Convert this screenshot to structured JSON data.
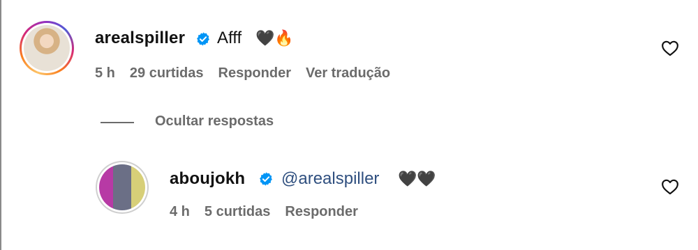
{
  "comments": [
    {
      "username": "arealspiller",
      "verified": true,
      "text": "Afff",
      "emoji": "🖤🔥",
      "time": "5 h",
      "likes": "29 curtidas",
      "reply_label": "Responder",
      "translate_label": "Ver tradução"
    }
  ],
  "replies_toggle": "Ocultar respostas",
  "replies": [
    {
      "username": "aboujokh",
      "verified": true,
      "mention": "@arealspiller",
      "emoji": "🖤🖤",
      "time": "4 h",
      "likes": "5 curtidas",
      "reply_label": "Responder"
    }
  ],
  "colors": {
    "verified_blue": "#0095f6",
    "meta_gray": "#6b6b6b",
    "mention_blue": "#2f4f7f"
  },
  "icons": [
    "verified-badge-icon",
    "heart-outline-icon"
  ]
}
